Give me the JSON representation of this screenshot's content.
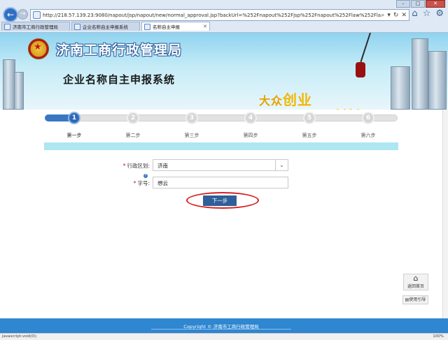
{
  "browser": {
    "url": "http://218.57.139.23:9080/napout/jsp/napout/new/normal_approval.jsp?backUrl=%252Fnapout%252Fjsp%252Fnapout%252Flaw%252Flaw.jsp%253Fnat%253Dbak&se",
    "tabs": [
      {
        "label": "济南市工商行政管理局",
        "active": false
      },
      {
        "label": "企业名称自主申报系统",
        "active": false
      },
      {
        "label": "名称自主申报",
        "active": true
      }
    ],
    "status_left": "javascript:void(0);",
    "status_right": "100%"
  },
  "banner": {
    "org_name": "济南工商行政管理局",
    "system_name": "企业名称自主申报系统",
    "slogan1_a": "大众",
    "slogan1_b": "创业",
    "slogan2_a": "万众",
    "slogan2_b": "创新"
  },
  "steps": {
    "numbers": [
      "1",
      "2",
      "3",
      "4",
      "5",
      "6"
    ],
    "labels": [
      "第一步",
      "第二步",
      "第三步",
      "第四步",
      "第五步",
      "第六步"
    ],
    "current": 1
  },
  "form": {
    "region_label": "行政区划:",
    "region_value": "济南",
    "name_label": "字号:",
    "name_value": "想云",
    "next_button": "下一步"
  },
  "side": {
    "home_label": "返回首页",
    "guide_label": "使用引导"
  },
  "footer": {
    "copyright": "Copyright © 济南市工商行政管理局"
  },
  "colors": {
    "brand_blue": "#2f86d1",
    "step_active": "#2e6ab6",
    "button": "#2f5f98",
    "annotation_red": "#d62222",
    "required": "#d0021b"
  }
}
